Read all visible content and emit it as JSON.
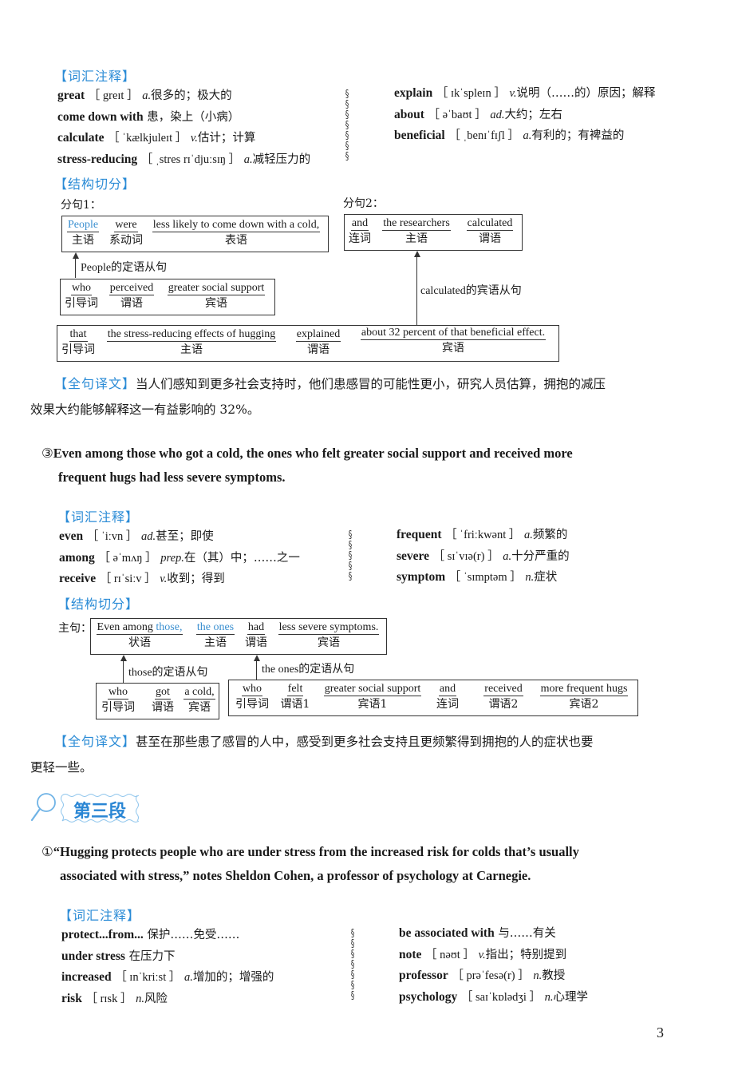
{
  "labels": {
    "vocab": "【词汇注释】",
    "structure": "【结构切分】",
    "translation": "【全句译文】",
    "clause1": "分句1：",
    "clause2": "分句2：",
    "main_clause": "主句："
  },
  "section1": {
    "vocab_left": [
      {
        "word": "great",
        "phonetic": "［ greɪt ］",
        "pos": "a.",
        "meaning": "很多的；极大的"
      },
      {
        "word": "come down with",
        "phonetic": "",
        "pos": "",
        "meaning": "患，染上（小病）"
      },
      {
        "word": "calculate",
        "phonetic": "［ ˈkælkjuleɪt ］",
        "pos": "v.",
        "meaning": "估计；计算"
      },
      {
        "word": "stress-reducing",
        "phonetic": "［ ˌstres rɪˈdjuːsɪŋ ］",
        "pos": "a.",
        "meaning": "减轻压力的"
      }
    ],
    "vocab_right": [
      {
        "word": "explain",
        "phonetic": "［ ɪkˈspleɪn ］",
        "pos": "v.",
        "meaning": "说明（……的）原因；解释"
      },
      {
        "word": "about",
        "phonetic": "［ əˈbaʊt ］",
        "pos": "ad.",
        "meaning": "大约；左右"
      },
      {
        "word": "beneficial",
        "phonetic": "［ ˌbenɪˈfɪʃl ］",
        "pos": "a.",
        "meaning": "有利的；有裨益的"
      }
    ],
    "clause1_box": [
      {
        "en": "People",
        "zh": "主语",
        "blue": true
      },
      {
        "en": "were",
        "zh": "系动词"
      },
      {
        "en": "less likely to come down with a cold,",
        "zh": "表语"
      }
    ],
    "clause1_link": "People的定语从句",
    "clause1_sub": [
      {
        "en": "who",
        "zh": "引导词"
      },
      {
        "en": "perceived",
        "zh": "谓语"
      },
      {
        "en": "greater social support",
        "zh": "宾语"
      }
    ],
    "clause2_box": [
      {
        "en": "and",
        "zh": "连词"
      },
      {
        "en": "the researchers",
        "zh": "主语"
      },
      {
        "en": "calculated",
        "zh": "谓语"
      }
    ],
    "clause2_link": "calculated的宾语从句",
    "clause2_sub": [
      {
        "en": "that",
        "zh": "引导词"
      },
      {
        "en": "the stress-reducing effects of hugging",
        "zh": "主语"
      },
      {
        "en": "explained",
        "zh": "谓语"
      },
      {
        "en": "about 32 percent of that beneficial effect.",
        "zh": "宾语"
      }
    ],
    "translation": "当人们感知到更多社会支持时，他们患感冒的可能性更小，研究人员估算，拥抱的减压",
    "translation_line2": "效果大约能够解释这一有益影响的 32%。"
  },
  "section2": {
    "number": "③",
    "sentence_line1": "Even among those who got a cold, the ones who felt greater social support and received more",
    "sentence_line2": "frequent hugs had less severe symptoms.",
    "vocab_left": [
      {
        "word": "even",
        "phonetic": "［ ˈiːvn ］",
        "pos": "ad.",
        "meaning": "甚至；即使"
      },
      {
        "word": "among",
        "phonetic": "［ əˈmʌŋ ］",
        "pos": "prep.",
        "meaning": "在（其）中；……之一"
      },
      {
        "word": "receive",
        "phonetic": "［ rɪˈsiːv ］",
        "pos": "v.",
        "meaning": "收到；得到"
      }
    ],
    "vocab_right": [
      {
        "word": "frequent",
        "phonetic": "［ ˈfriːkwənt ］",
        "pos": "a.",
        "meaning": "频繁的"
      },
      {
        "word": "severe",
        "phonetic": "［ sɪˈvɪə(r) ］",
        "pos": "a.",
        "meaning": "十分严重的"
      },
      {
        "word": "symptom",
        "phonetic": "［ ˈsɪmptəm ］",
        "pos": "n.",
        "meaning": "症状"
      }
    ],
    "main_box": [
      {
        "en_pre": "Even among ",
        "en_blue": "those,",
        "zh": "状语"
      },
      {
        "en": "the ones",
        "zh": "主语",
        "blue": true
      },
      {
        "en": "had",
        "zh": "谓语"
      },
      {
        "en": "less severe symptoms.",
        "zh": "宾语"
      }
    ],
    "link_left": "those的定语从句",
    "link_right": "the ones的定语从句",
    "sub_left": [
      {
        "en": "who",
        "zh": "引导词"
      },
      {
        "en": "got",
        "zh": "谓语"
      },
      {
        "en": "a cold,",
        "zh": "宾语"
      }
    ],
    "sub_right": [
      {
        "en": "who",
        "zh": "引导词"
      },
      {
        "en": "felt",
        "zh": "谓语1"
      },
      {
        "en": "greater social support",
        "zh": "宾语1"
      },
      {
        "en": "and",
        "zh": "连词"
      },
      {
        "en": "received",
        "zh": "谓语2"
      },
      {
        "en": "more frequent hugs",
        "zh": "宾语2"
      }
    ],
    "translation": "甚至在那些患了感冒的人中，感受到更多社会支持且更频繁得到拥抱的人的症状也要",
    "translation_line2": "更轻一些。"
  },
  "section3": {
    "heading": "第三段",
    "number": "①",
    "sentence_line1": "“Hugging protects people who are under stress from the increased risk for colds that’s usually",
    "sentence_line2": "associated with stress,” notes Sheldon Cohen, a professor of psychology at Carnegie.",
    "vocab_left": [
      {
        "word": "protect...from...",
        "phonetic": "",
        "pos": "",
        "meaning": "保护……免受……"
      },
      {
        "word": "under stress",
        "phonetic": "",
        "pos": "",
        "meaning": "在压力下"
      },
      {
        "word": "increased",
        "phonetic": "［ ɪnˈkriːst ］",
        "pos": "a.",
        "meaning": "增加的；增强的"
      },
      {
        "word": "risk",
        "phonetic": "［ rɪsk ］",
        "pos": "n.",
        "meaning": "风险"
      }
    ],
    "vocab_right": [
      {
        "word": "be associated with",
        "phonetic": "",
        "pos": "",
        "meaning": "与……有关"
      },
      {
        "word": "note",
        "phonetic": "［ nəʊt ］",
        "pos": "v.",
        "meaning": "指出；特别提到"
      },
      {
        "word": "professor",
        "phonetic": "［ prəˈfesə(r) ］",
        "pos": "n.",
        "meaning": "教授"
      },
      {
        "word": "psychology",
        "phonetic": "［ saɪˈkɒlədʒi ］",
        "pos": "n.",
        "meaning": "心理学"
      }
    ]
  },
  "page_number": "3",
  "colors": {
    "accent": "#2a8bd6",
    "text": "#1a1a1a"
  }
}
